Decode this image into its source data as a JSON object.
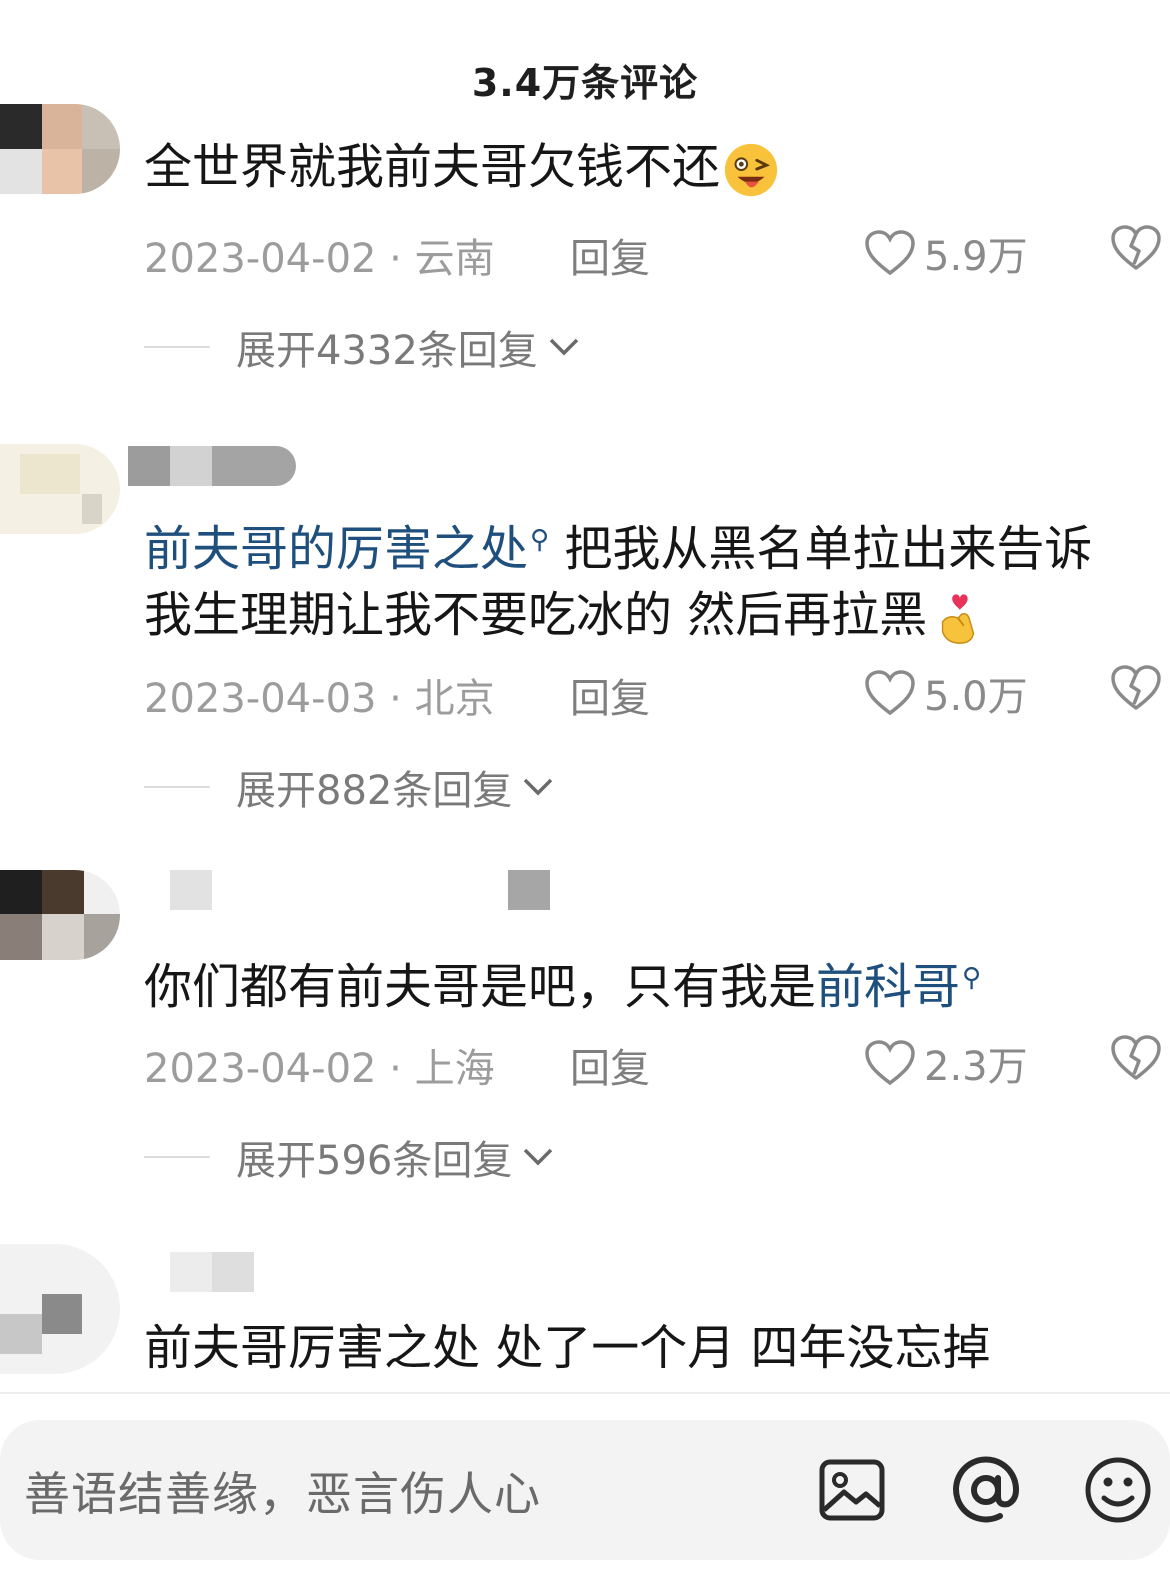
{
  "header": {
    "title": "3.4万条评论"
  },
  "comments": [
    {
      "text": "全世界就我前夫哥欠钱不还",
      "emoji": "winking-tongue-emoji",
      "date": "2023-04-02 · 云南",
      "reply_label": "回复",
      "likes": "5.9万",
      "expand_label": "展开4332条回复"
    },
    {
      "link_text": "前夫哥的厉害之处",
      "text_line1": "把我从黑名单拉出来告诉",
      "text_line2": "我生理期让我不要吃冰的 然后再拉黑",
      "emoji": "finger-heart-emoji",
      "date": "2023-04-03 · 北京",
      "reply_label": "回复",
      "likes": "5.0万",
      "expand_label": "展开882条回复"
    },
    {
      "text": "你们都有前夫哥是吧，只有我是",
      "link_text": "前科哥",
      "date": "2023-04-02 · 上海",
      "reply_label": "回复",
      "likes": "2.3万",
      "expand_label": "展开596条回复"
    },
    {
      "text": "前夫哥厉害之处 处了一个月 四年没忘掉"
    }
  ],
  "input": {
    "placeholder": "善语结善缘，恶言伤人心",
    "icons": [
      "image-icon",
      "at-icon",
      "emoji-icon"
    ]
  },
  "colors": {
    "link": "#1e4f7d",
    "meta": "#9c9c9c",
    "input_bg": "#f3f3f3"
  }
}
